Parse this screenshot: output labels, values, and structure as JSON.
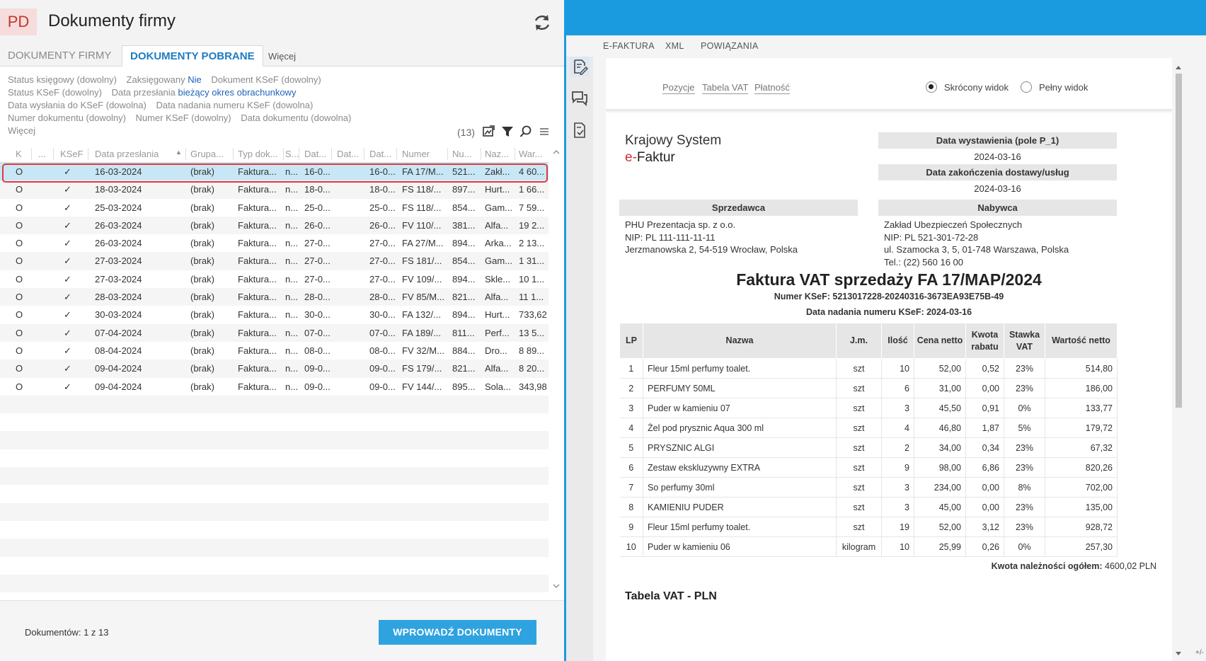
{
  "app": {
    "badge": "PD",
    "title": "Dokumenty firmy",
    "refresh_icon": "refresh-icon"
  },
  "tabs": [
    {
      "label": "DOKUMENTY FIRMY",
      "active": false
    },
    {
      "label": "DOKUMENTY POBRANE",
      "active": true
    },
    {
      "label": "Więcej",
      "active": false
    }
  ],
  "filters": {
    "status_ksiegowy": "Status księgowy (dowolny)",
    "zaksiegowany_label": "Zaksięgowany",
    "zaksiegowany_value": "Nie",
    "dokument_ksef": "Dokument KSeF (dowolny)",
    "status_ksef": "Status KSeF (dowolny)",
    "data_przeslania_label": "Data przesłania",
    "data_przeslania_value": "bieżący okres obrachunkowy",
    "data_wyslania": "Data wysłania do KSeF (dowolna)",
    "data_nadania": "Data nadania numeru KSeF (dowolna)",
    "numer_dokumentu": "Numer dokumentu (dowolny)",
    "numer_ksef": "Numer KSeF (dowolny)",
    "data_dokumentu": "Data dokumentu (dowolna)",
    "wiecej": "Więcej"
  },
  "toolbar": {
    "count": "(13)",
    "icons": [
      "export-icon",
      "filter-icon",
      "search-icon",
      "menu-icon"
    ]
  },
  "grid": {
    "columns": [
      "K",
      "...",
      "KSeF",
      "Data przesłania",
      "Grupa...",
      "Typ dok...",
      "S...",
      "Dat...",
      "Dat...",
      "Dat...",
      "Numer",
      "Nu...",
      "Naz...",
      "War..."
    ],
    "rows": [
      {
        "k": "O",
        "ksef": "✓",
        "data": "16-03-2024",
        "grupa": "(brak)",
        "typ": "Faktura...",
        "s": "n...",
        "d1": "16-0...",
        "d3": "16-0...",
        "numer": "FA 17/M...",
        "nu": "521...",
        "naz": "Zakł...",
        "war": "4 60..."
      },
      {
        "k": "O",
        "ksef": "✓",
        "data": "18-03-2024",
        "grupa": "(brak)",
        "typ": "Faktura...",
        "s": "n...",
        "d1": "18-0...",
        "d3": "18-0...",
        "numer": "FS 118/...",
        "nu": "897...",
        "naz": "Hurt...",
        "war": "1 66..."
      },
      {
        "k": "O",
        "ksef": "✓",
        "data": "25-03-2024",
        "grupa": "(brak)",
        "typ": "Faktura...",
        "s": "n...",
        "d1": "25-0...",
        "d3": "25-0...",
        "numer": "FS 118/...",
        "nu": "854...",
        "naz": "Gam...",
        "war": "7 59..."
      },
      {
        "k": "O",
        "ksef": "✓",
        "data": "26-03-2024",
        "grupa": "(brak)",
        "typ": "Faktura...",
        "s": "n...",
        "d1": "26-0...",
        "d3": "26-0...",
        "numer": "FV 110/...",
        "nu": "381...",
        "naz": "Alfa...",
        "war": "19 2..."
      },
      {
        "k": "O",
        "ksef": "✓",
        "data": "26-03-2024",
        "grupa": "(brak)",
        "typ": "Faktura...",
        "s": "n...",
        "d1": "27-0...",
        "d3": "27-0...",
        "numer": "FA 27/M...",
        "nu": "894...",
        "naz": "Arka...",
        "war": "2 13..."
      },
      {
        "k": "O",
        "ksef": "✓",
        "data": "27-03-2024",
        "grupa": "(brak)",
        "typ": "Faktura...",
        "s": "n...",
        "d1": "27-0...",
        "d3": "27-0...",
        "numer": "FS 181/...",
        "nu": "854...",
        "naz": "Gam...",
        "war": "1 31..."
      },
      {
        "k": "O",
        "ksef": "✓",
        "data": "27-03-2024",
        "grupa": "(brak)",
        "typ": "Faktura...",
        "s": "n...",
        "d1": "27-0...",
        "d3": "27-0...",
        "numer": "FV 109/...",
        "nu": "894...",
        "naz": "Skle...",
        "war": "10 1..."
      },
      {
        "k": "O",
        "ksef": "✓",
        "data": "28-03-2024",
        "grupa": "(brak)",
        "typ": "Faktura...",
        "s": "n...",
        "d1": "28-0...",
        "d3": "28-0...",
        "numer": "FV 85/M...",
        "nu": "821...",
        "naz": "Alfa...",
        "war": "11 1..."
      },
      {
        "k": "O",
        "ksef": "✓",
        "data": "30-03-2024",
        "grupa": "(brak)",
        "typ": "Faktura...",
        "s": "n...",
        "d1": "30-0...",
        "d3": "30-0...",
        "numer": "FA 132/...",
        "nu": "894...",
        "naz": "Hurt...",
        "war": "733,62"
      },
      {
        "k": "O",
        "ksef": "✓",
        "data": "07-04-2024",
        "grupa": "(brak)",
        "typ": "Faktura...",
        "s": "n...",
        "d1": "07-0...",
        "d3": "07-0...",
        "numer": "FA 189/...",
        "nu": "811...",
        "naz": "Perf...",
        "war": "13 5..."
      },
      {
        "k": "O",
        "ksef": "✓",
        "data": "08-04-2024",
        "grupa": "(brak)",
        "typ": "Faktura...",
        "s": "n...",
        "d1": "08-0...",
        "d3": "08-0...",
        "numer": "FV 32/M...",
        "nu": "884...",
        "naz": "Dro...",
        "war": "8 89..."
      },
      {
        "k": "O",
        "ksef": "✓",
        "data": "09-04-2024",
        "grupa": "(brak)",
        "typ": "Faktura...",
        "s": "n...",
        "d1": "09-0...",
        "d3": "09-0...",
        "numer": "FS 179/...",
        "nu": "821...",
        "naz": "Alfa...",
        "war": "8 20..."
      },
      {
        "k": "O",
        "ksef": "✓",
        "data": "09-04-2024",
        "grupa": "(brak)",
        "typ": "Faktura...",
        "s": "n...",
        "d1": "09-0...",
        "d3": "09-0...",
        "numer": "FV 144/...",
        "nu": "895...",
        "naz": "Sola...",
        "war": "343,98"
      }
    ]
  },
  "footer": {
    "doc_count": "Dokumentów: 1 z 13",
    "import_button": "WPROWADŹ DOKUMENTY"
  },
  "right": {
    "tabs": [
      "E-FAKTURA",
      "XML",
      "POWIĄZANIA"
    ],
    "rail_icons": [
      "edit-document-icon",
      "comments-icon",
      "document-check-icon"
    ],
    "nav_links": [
      "Pozycje",
      "Tabela VAT",
      "Płatność"
    ],
    "view_short": "Skrócony widok",
    "view_full": "Pełny widok",
    "logo_line1": "Krajowy System",
    "logo_e": "e-",
    "logo_line2": "Faktur",
    "issue_date_label": "Data wystawienia (pole P_1)",
    "issue_date": "2024-03-16",
    "delivery_date_label": "Data zakończenia dostawy/usług",
    "delivery_date": "2024-03-16",
    "seller_label": "Sprzedawca",
    "seller": [
      "PHU Prezentacja sp. z o.o.",
      "NIP: PL 111-111-11-11",
      "Jerzmanowska 2, 54-519 Wrocław, Polska"
    ],
    "buyer_label": "Nabywca",
    "buyer": [
      "Zakład Ubezpieczeń Społecznych",
      "NIP: PL 521-301-72-28",
      "ul. Szamocka 3, 5, 01-748 Warszawa, Polska",
      "Tel.: (22) 560 16 00"
    ],
    "invoice_title": "Faktura VAT sprzedaży FA 17/MAP/2024",
    "ksef_number": "Numer KSeF: 5213017228-20240316-3673EA93E75B-49",
    "ksef_date": "Data nadania numeru KSeF: 2024-03-16",
    "items_headers": [
      "LP",
      "Nazwa",
      "J.m.",
      "Ilość",
      "Cena netto",
      "Kwota rabatu",
      "Stawka VAT",
      "Wartość netto"
    ],
    "items": [
      [
        "1",
        "Fleur 15ml perfumy toalet.",
        "szt",
        "10",
        "52,00",
        "0,52",
        "23%",
        "514,80"
      ],
      [
        "2",
        "PERFUMY 50ML",
        "szt",
        "6",
        "31,00",
        "0,00",
        "23%",
        "186,00"
      ],
      [
        "3",
        "Puder w kamieniu 07",
        "szt",
        "3",
        "45,50",
        "0,91",
        "0%",
        "133,77"
      ],
      [
        "4",
        "Żel pod prysznic Aqua 300 ml",
        "szt",
        "4",
        "46,80",
        "1,87",
        "5%",
        "179,72"
      ],
      [
        "5",
        "PRYSZNIC ALGI",
        "szt",
        "2",
        "34,00",
        "0,34",
        "23%",
        "67,32"
      ],
      [
        "6",
        "Zestaw ekskluzywny EXTRA",
        "szt",
        "9",
        "98,00",
        "6,86",
        "23%",
        "820,26"
      ],
      [
        "7",
        "So perfumy 30ml",
        "szt",
        "3",
        "234,00",
        "0,00",
        "8%",
        "702,00"
      ],
      [
        "8",
        "KAMIENIU PUDER",
        "szt",
        "3",
        "45,00",
        "0,00",
        "23%",
        "135,00"
      ],
      [
        "9",
        "Fleur 15ml perfumy toalet.",
        "szt",
        "19",
        "52,00",
        "3,12",
        "23%",
        "928,72"
      ],
      [
        "10",
        "Puder w kamieniu 06",
        "kilogram",
        "10",
        "25,99",
        "0,26",
        "0%",
        "257,30"
      ]
    ],
    "total_label": "Kwota należności ogółem:",
    "total_value": "4600,02 PLN",
    "vat_table_title": "Tabela VAT - PLN",
    "corner": "+/-"
  },
  "colors": {
    "accent_blue": "#1a9be0",
    "selected_row": "#c7e7f6",
    "selection_outline": "#e03a3a",
    "button_blue": "#2ea3e0",
    "badge_bg": "#f6dcdc",
    "badge_fg": "#c0392b"
  }
}
